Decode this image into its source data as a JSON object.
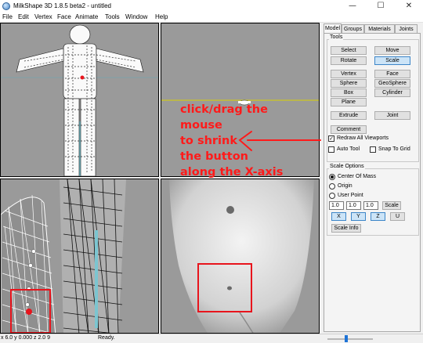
{
  "window": {
    "title": "MilkShape 3D 1.8.5 beta2 - untitled",
    "minimize": "—",
    "maximize": "☐",
    "close": "✕"
  },
  "menu": {
    "items": [
      "File",
      "Edit",
      "Vertex",
      "Face",
      "Animate",
      "Tools",
      "Window",
      "Help"
    ]
  },
  "annotation": {
    "lines": [
      "click/drag the",
      "mouse",
      "to shrink",
      "the button",
      "along  the X-axis"
    ],
    "color": "#ff1a1a"
  },
  "panel": {
    "tabs": [
      "Model",
      "Groups",
      "Materials",
      "Joints"
    ],
    "active_tab": "Model",
    "tools_label": "Tools",
    "tools": {
      "select": "Select",
      "move": "Move",
      "rotate": "Rotate",
      "scale": "Scale",
      "vertex": "Vertex",
      "face": "Face",
      "sphere": "Sphere",
      "geosphere": "GeoSphere",
      "box": "Box",
      "cylinder": "Cylinder",
      "plane": "Plane",
      "extrude": "Extrude",
      "joint": "Joint",
      "comment": "Comment"
    },
    "redraw_all_viewports": {
      "label": "Redraw All Viewports",
      "checked": true
    },
    "auto_tool": {
      "label": "Auto Tool",
      "checked": false
    },
    "snap_to_grid": {
      "label": "Snap To Grid",
      "checked": false
    },
    "scale_options": {
      "label": "Scale Options",
      "center_of_mass": "Center Of Mass",
      "origin": "Origin",
      "user_point": "User Point",
      "selected": "Center Of Mass",
      "x_value": "1.0",
      "y_value": "1.0",
      "z_value": "1.0",
      "scale_button": "Scale",
      "x_axis": "X",
      "y_axis": "Y",
      "z_axis": "Z",
      "uniform": "U",
      "scale_info": "Scale Info"
    }
  },
  "status": {
    "coords": "x 6.0  y 0.000  z 2.0  9",
    "ready": "Ready.",
    "zoom_fraction": 0.4
  },
  "colors": {
    "viewport_bg": "#9a9a9a",
    "highlight": "#e8141c",
    "selected_button": "#cce4f7",
    "slider": "#1e73d6"
  }
}
